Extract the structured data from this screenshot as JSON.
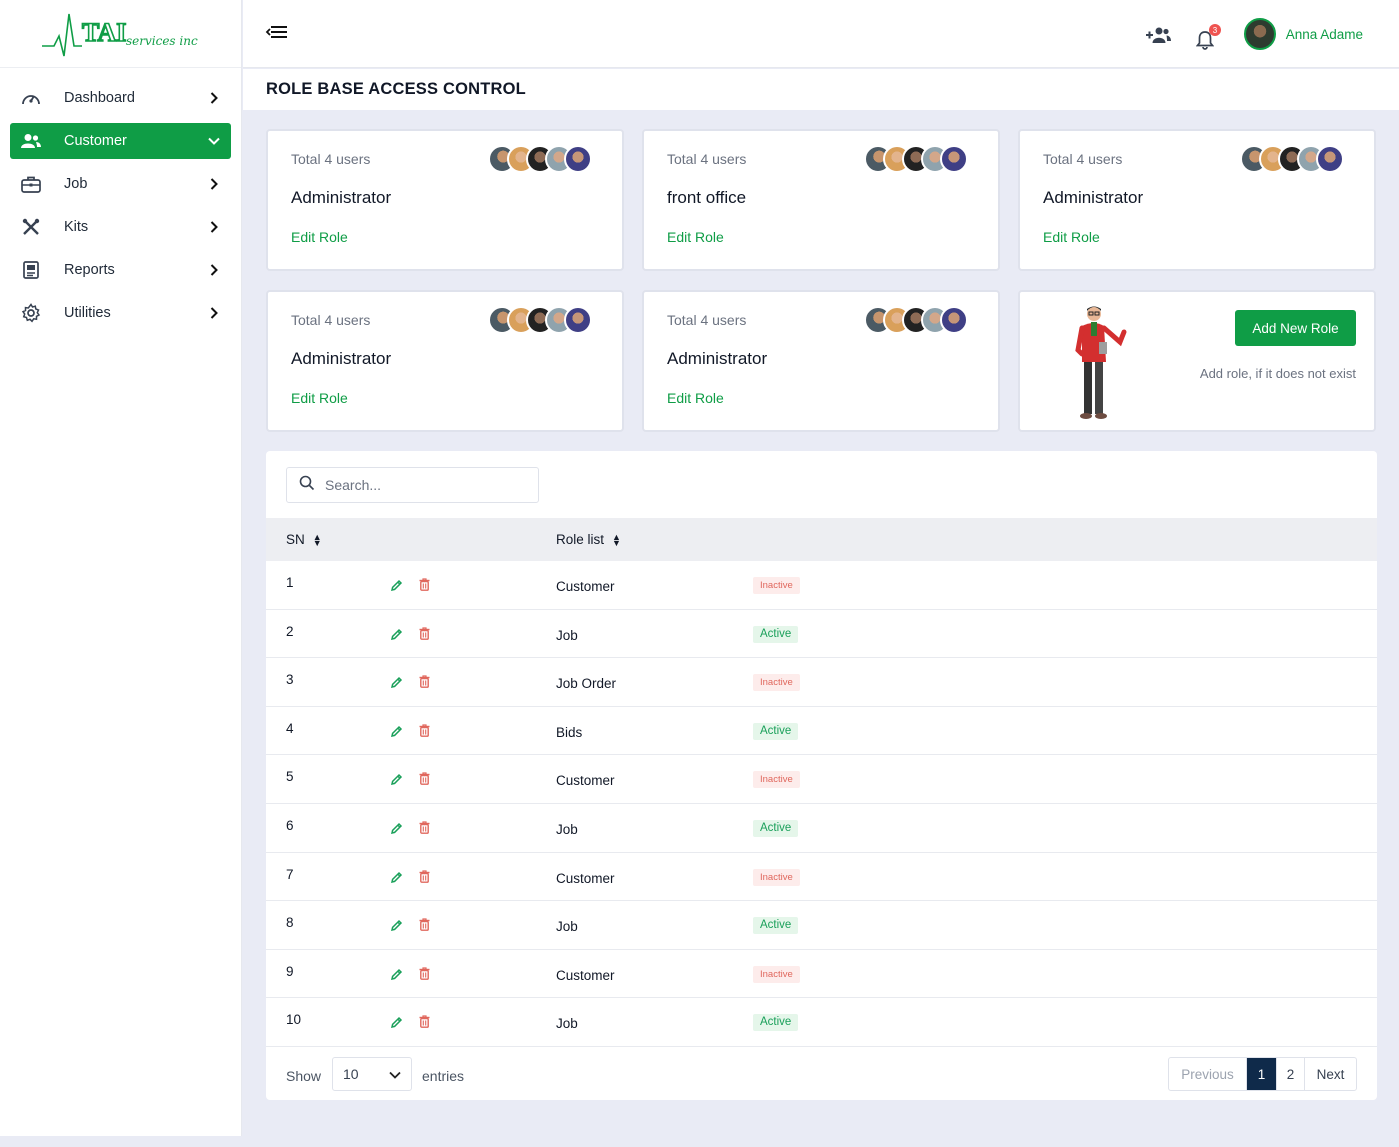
{
  "brand": {
    "logo_text": "TAI",
    "logo_sub": "services inc"
  },
  "sidebar": {
    "items": [
      {
        "label": "Dashboard",
        "icon": "gauge-icon"
      },
      {
        "label": "Customer",
        "icon": "users-icon",
        "active": true
      },
      {
        "label": "Job",
        "icon": "briefcase-icon"
      },
      {
        "label": "Kits",
        "icon": "tools-icon"
      },
      {
        "label": "Reports",
        "icon": "report-icon"
      },
      {
        "label": "Utilities",
        "icon": "gear-icon"
      }
    ]
  },
  "topbar": {
    "notification_count": "3",
    "user_name": "Anna Adame"
  },
  "page": {
    "title": "ROLE BASE ACCESS CONTROL"
  },
  "cards": [
    {
      "users": "Total 4 users",
      "role": "Administrator",
      "edit": "Edit Role"
    },
    {
      "users": "Total 4 users",
      "role": "front office",
      "edit": "Edit Role"
    },
    {
      "users": "Total 4 users",
      "role": "Administrator",
      "edit": "Edit Role"
    },
    {
      "users": "Total 4 users",
      "role": "Administrator",
      "edit": "Edit Role"
    },
    {
      "users": "Total 4 users",
      "role": "Administrator",
      "edit": "Edit Role"
    }
  ],
  "add_card": {
    "button": "Add New Role",
    "hint": "Add role, if it does not  exist"
  },
  "table": {
    "search_placeholder": "Search...",
    "columns": {
      "sn": "SN",
      "role": "Role list"
    },
    "rows": [
      {
        "sn": "1",
        "role": "Customer",
        "status": "Inactive"
      },
      {
        "sn": "2",
        "role": "Job",
        "status": "Active"
      },
      {
        "sn": "3",
        "role": "Job Order",
        "status": "Inactive"
      },
      {
        "sn": "4",
        "role": "Bids",
        "status": "Active"
      },
      {
        "sn": "5",
        "role": "Customer",
        "status": "Inactive"
      },
      {
        "sn": "6",
        "role": "Job",
        "status": "Active"
      },
      {
        "sn": "7",
        "role": "Customer",
        "status": "Inactive"
      },
      {
        "sn": "8",
        "role": "Job",
        "status": "Active"
      },
      {
        "sn": "9",
        "role": "Customer",
        "status": "Inactive"
      },
      {
        "sn": "10",
        "role": "Job",
        "status": "Active"
      }
    ],
    "footer": {
      "show": "Show",
      "page_size": "10",
      "entries": "entries",
      "previous": "Previous",
      "pages": [
        "1",
        "2"
      ],
      "next": "Next"
    }
  },
  "colors": {
    "accent": "#0f9d46",
    "pager_active": "#0f2a4a",
    "active_badge": "#1aa05a",
    "inactive_badge": "#e0675d"
  }
}
